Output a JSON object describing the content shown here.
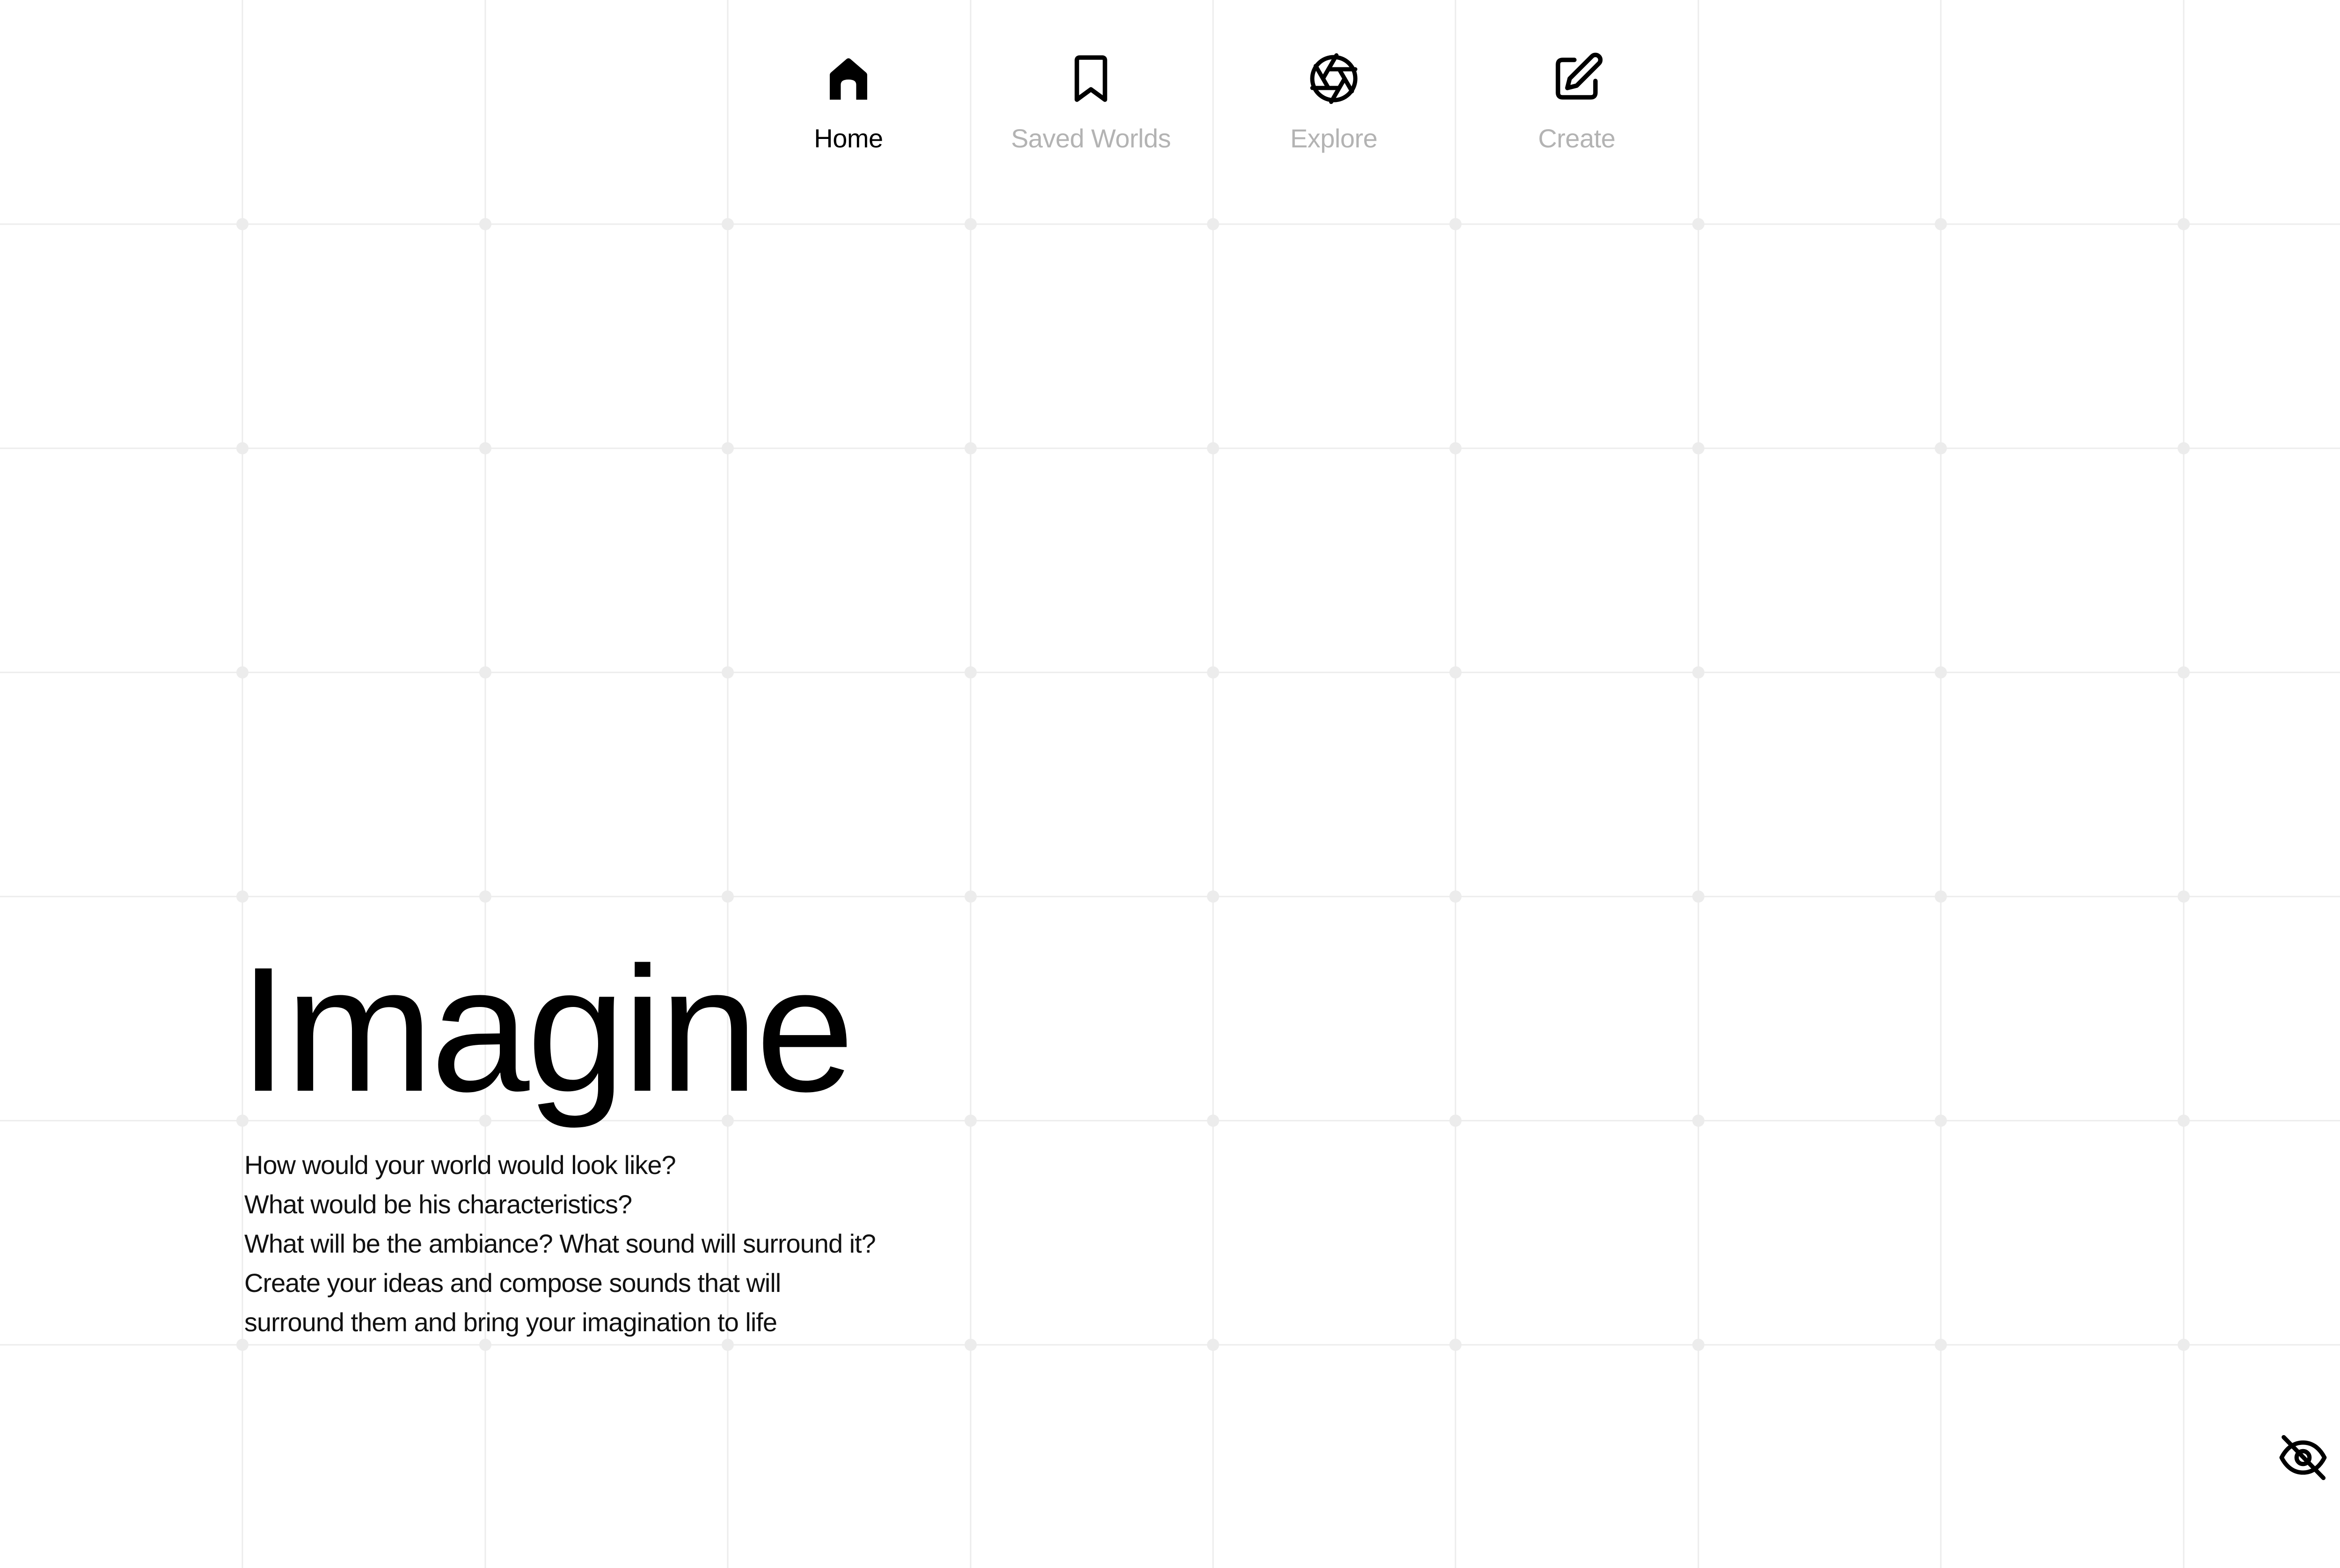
{
  "nav": {
    "items": [
      {
        "label": "Home",
        "icon": "home-icon",
        "active": true
      },
      {
        "label": "Saved Worlds",
        "icon": "bookmark-icon",
        "active": false
      },
      {
        "label": "Explore",
        "icon": "aperture-icon",
        "active": false
      },
      {
        "label": "Create",
        "icon": "edit-icon",
        "active": false
      }
    ]
  },
  "hero": {
    "title": "Imagine",
    "description": [
      "How would your world would look like?",
      "What would be his characteristics?",
      "What will be the ambiance? What sound will surround it?",
      "Create your ideas and compose sounds that will",
      "surround them and bring your imagination to life"
    ]
  },
  "controls": {
    "visibility_icon": "eye-off-icon"
  },
  "colors": {
    "background": "#ffffff",
    "active_text": "#000000",
    "inactive_text": "#b3b3b3",
    "grid_line": "#ececec"
  }
}
